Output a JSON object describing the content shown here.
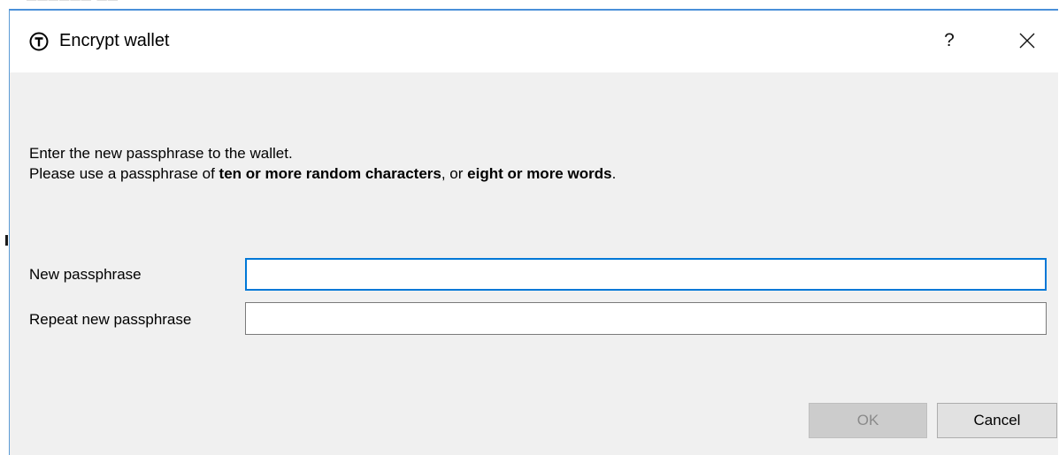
{
  "window": {
    "title": "Encrypt wallet",
    "help_label": "?",
    "icon": "coin-logo-icon",
    "accent_color": "#0078d7"
  },
  "message": {
    "line1": "Enter the new passphrase to the wallet.",
    "line2_prefix": "Please use a passphrase of ",
    "line2_bold1": "ten or more random characters",
    "line2_mid": ", or ",
    "line2_bold2": "eight or more words",
    "line2_suffix": "."
  },
  "form": {
    "new_passphrase_label": "New passphrase",
    "new_passphrase_value": "",
    "repeat_passphrase_label": "Repeat new passphrase",
    "repeat_passphrase_value": ""
  },
  "buttons": {
    "ok_label": "OK",
    "ok_enabled": false,
    "cancel_label": "Cancel"
  }
}
